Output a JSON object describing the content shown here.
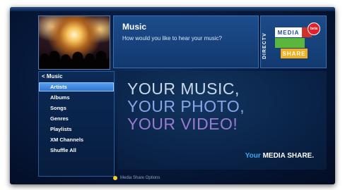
{
  "header": {
    "title": "Music",
    "subtitle": "How would you like to hear your music?"
  },
  "brand": {
    "directv": "DIRECTV",
    "media": "MEDIA",
    "share": "SHARE",
    "beta": "beta"
  },
  "nav": {
    "breadcrumb": "< Music",
    "items": [
      {
        "label": "Artists",
        "selected": true
      },
      {
        "label": "Albums"
      },
      {
        "label": "Songs"
      },
      {
        "label": "Genres"
      },
      {
        "label": "Playlists"
      },
      {
        "label": "XM Channels"
      },
      {
        "label": "Shuffle All"
      }
    ]
  },
  "hero": {
    "line1": "YOUR MUSIC,",
    "line2": "YOUR PHOTO,",
    "line3": "YOUR VIDEO!",
    "tag_your": "Your",
    "tag_media_share": "MEDIA SHARE."
  },
  "footer": {
    "label": "Media Share Options"
  },
  "colors": {
    "selected_item": "#3a88e6",
    "tag_your": "#3ea8f2",
    "footer_dot": "#f4d02a"
  }
}
